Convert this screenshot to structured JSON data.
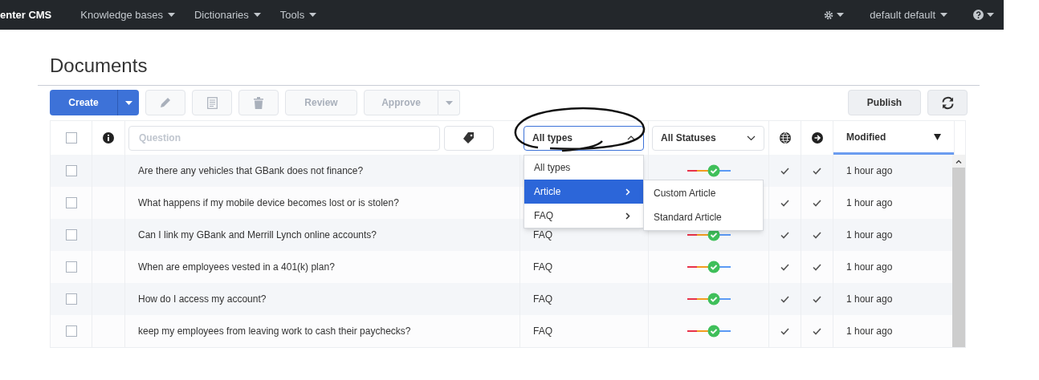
{
  "navbar": {
    "brand": "enter CMS",
    "menus": [
      "Knowledge bases",
      "Dictionaries",
      "Tools"
    ],
    "user": "default default"
  },
  "title": "Documents",
  "toolbar": {
    "create": "Create",
    "icon_buttons": [
      {
        "kind": "edit",
        "disabled": true
      },
      {
        "kind": "copy",
        "disabled": true
      },
      {
        "kind": "delete",
        "disabled": true
      }
    ],
    "review": {
      "label": "Review",
      "disabled": true
    },
    "approve": {
      "label": "Approve",
      "disabled": true
    },
    "publish": "Publish"
  },
  "filters": {
    "select_all_checked": false,
    "question_placeholder": "Question",
    "type": "All types",
    "type_open": true,
    "status": "All Statuses",
    "sort_column": "Modified"
  },
  "type_menu": [
    {
      "label": "All types",
      "selected": false,
      "submenu": false
    },
    {
      "label": "Article",
      "selected": true,
      "submenu": true
    },
    {
      "label": "FAQ",
      "selected": false,
      "submenu": true
    }
  ],
  "submenu": [
    "Custom Article",
    "Standard Article"
  ],
  "rows": [
    {
      "checked": false,
      "question": "Are there any vehicles that GBank does not finance?",
      "type": "",
      "globe_check": true,
      "arrow_check": true,
      "modified": "1 hour ago"
    },
    {
      "checked": false,
      "question": "What happens if my mobile device becomes lost or is stolen?",
      "type": "",
      "status_hidden": true,
      "globe_check": true,
      "arrow_check": true,
      "modified": "1 hour ago"
    },
    {
      "checked": false,
      "question": "Can I link my GBank and Merrill Lynch online accounts?",
      "type": "FAQ",
      "globe_check": true,
      "arrow_check": true,
      "modified": "1 hour ago"
    },
    {
      "checked": false,
      "question": "When are employees vested in a 401(k) plan?",
      "type": "FAQ",
      "globe_check": true,
      "arrow_check": true,
      "modified": "1 hour ago"
    },
    {
      "checked": false,
      "question": "How do I access my account?",
      "type": "FAQ",
      "globe_check": true,
      "arrow_check": true,
      "modified": "1 hour ago"
    },
    {
      "checked": false,
      "question": "keep my employees from leaving work to cash their paychecks?",
      "type": "FAQ",
      "globe_check": true,
      "arrow_check": true,
      "modified": "1 hour ago"
    }
  ]
}
